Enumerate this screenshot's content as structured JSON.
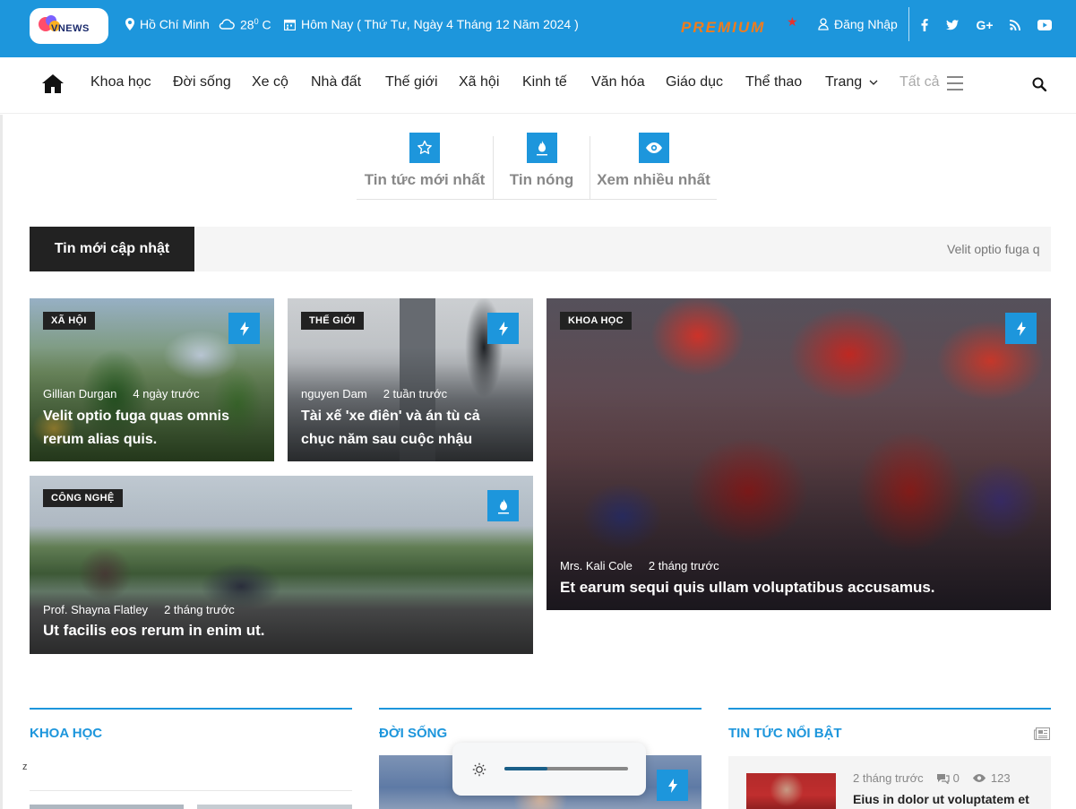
{
  "topbar": {
    "logo_text": "VNEWS",
    "location": "Hồ Chí Minh",
    "temperature_value": "28",
    "temperature_sup": "0",
    "temperature_unit": "C",
    "date": "Hôm Nay ( Thứ Tư, Ngày 4 Tháng 12 Năm 2024 )",
    "premium": "PREMIUM",
    "premium_star": "★",
    "login": "Đăng Nhập",
    "socials": [
      "facebook-icon",
      "twitter-icon",
      "google-plus-icon",
      "rss-icon",
      "youtube-icon"
    ],
    "accent_color": "#1d96dc"
  },
  "nav": {
    "items": [
      "Khoa học",
      "Đời sống",
      "Xe cộ",
      "Nhà đất",
      "Thế giới",
      "Xã hội",
      "Kinh tế",
      "Văn hóa",
      "Giáo dục",
      "Thể thao",
      "Trang",
      "Tất cả"
    ]
  },
  "tabs": [
    {
      "label": "Tin tức mới nhất",
      "icon": "star-icon"
    },
    {
      "label": "Tin nóng",
      "icon": "fire-icon"
    },
    {
      "label": "Xem nhiều nhất",
      "icon": "eye-icon"
    }
  ],
  "ticker": {
    "label": "Tin mới cập nhật",
    "text": "Velit optio fuga quas omnis rerum alias quis."
  },
  "cards": [
    {
      "category": "XÃ HỘI",
      "author": "Gillian Durgan",
      "time": "4 ngày trước",
      "title": "Velit optio fuga quas omnis rerum alias quis.",
      "icon": "bolt-icon"
    },
    {
      "category": "THẾ GIỚI",
      "author": "nguyen Dam",
      "time": "2 tuần trước",
      "title": "Tài xế 'xe điên' và án tù cả chục năm sau cuộc nhậu",
      "icon": "bolt-icon"
    },
    {
      "category": "KHOA HỌC",
      "author": "Mrs. Kali Cole",
      "time": "2 tháng trước",
      "title": "Et earum sequi quis ullam voluptatibus accusamus.",
      "icon": "bolt-icon"
    },
    {
      "category": "CÔNG NGHỆ",
      "author": "Prof. Shayna Flatley",
      "time": "2 tháng trước",
      "title": "Ut facilis eos rerum in enim ut.",
      "icon": "fire-icon"
    }
  ],
  "sections": [
    {
      "title": "KHOA HỌC"
    },
    {
      "title": "ĐỜI SỐNG"
    },
    {
      "title": "TIN TỨC NỔI BẬT"
    }
  ],
  "stray_char": "z",
  "featured": {
    "time": "2 tháng trước",
    "comments": "0",
    "views": "123",
    "title": "Eius in dolor ut voluptatem et"
  },
  "brightness_popup": {
    "level": 0.35
  }
}
